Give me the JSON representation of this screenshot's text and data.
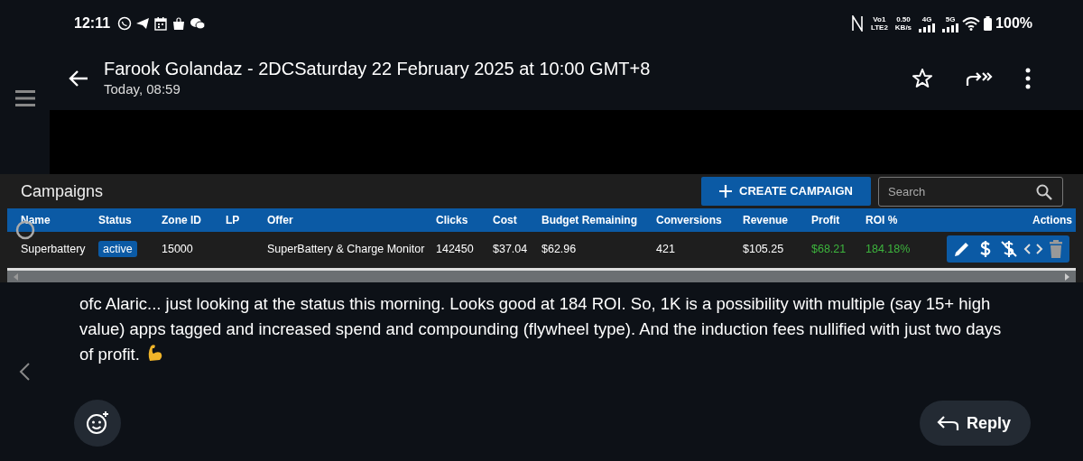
{
  "status_bar": {
    "time": "12:11",
    "volte_top": "Vo1",
    "volte_bottom": "LTE2",
    "speed_value": "0.50",
    "speed_unit": "KB/s",
    "network_1": "4G",
    "network_2": "5G",
    "battery": "100%"
  },
  "header": {
    "title": "Farook  Golandaz - 2DCSaturday 22 February 2025 at 10:00 GMT+8",
    "subtitle": "Today, 08:59"
  },
  "campaigns": {
    "title": "Campaigns",
    "create_button": "CREATE CAMPAIGN",
    "search": {
      "placeholder": "Search"
    },
    "columns": [
      "Name",
      "Status",
      "Zone ID",
      "LP",
      "Offer",
      "Clicks",
      "Cost",
      "Budget Remaining",
      "Conversions",
      "Revenue",
      "Profit",
      "ROI %",
      "Actions"
    ],
    "rows": [
      {
        "name": "Superbattery",
        "status": "active",
        "zone_id": "15000",
        "offer": "SuperBattery & Charge Monitor",
        "clicks": "142450",
        "cost": "$37.04",
        "budget_remaining": "$62.96",
        "conversions": "421",
        "revenue": "$105.25",
        "profit": "$68.21",
        "roi": "184.18%",
        "positive": true
      }
    ]
  },
  "message": {
    "text": "ofc Alaric... just looking at the status this morning. Looks good at 184 ROI. So, 1K is a possibility with multiple (say 15+ high value) apps tagged and increased spend and compounding (flywheel type). And the induction fees nullified with just two days of profit."
  },
  "reply_button": "Reply"
}
